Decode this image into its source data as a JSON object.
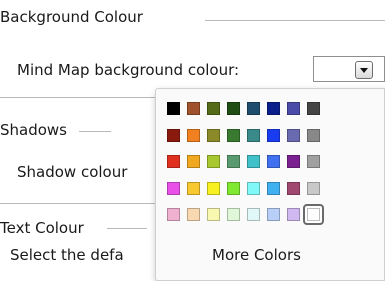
{
  "background": {
    "title": "Background Colour",
    "field_label": "Mind Map background colour:",
    "selected_value": ""
  },
  "shadows": {
    "title": "Shadows",
    "field_label": "Shadow colour"
  },
  "text_colour": {
    "title": "Text Colour",
    "description": "Select the defa"
  },
  "color_popup": {
    "more_colors_label": "More Colors",
    "selected_swatch": "#ffffff",
    "rows": [
      [
        "#000000",
        "#a0522d",
        "#556b1a",
        "#1f4d14",
        "#1e4d6e",
        "#0a1e8c",
        "#4a4aa8",
        "#444444"
      ],
      [
        "#8b1a0e",
        "#f08020",
        "#8a8a28",
        "#3a7a30",
        "#3a8a8a",
        "#1a3cf0",
        "#6a6ab0",
        "#888888"
      ],
      [
        "#e03020",
        "#f0a820",
        "#a8c830",
        "#5a9a70",
        "#40c0c8",
        "#4070f0",
        "#7a2090",
        "#a0a0a0"
      ],
      [
        "#e850e8",
        "#f8c830",
        "#f8f020",
        "#80e830",
        "#80f8f8",
        "#40b0f0",
        "#a04870",
        "#c8c8c8"
      ],
      [
        "#f0b0d0",
        "#f8d8b0",
        "#f8f8b0",
        "#e0f8d8",
        "#e0f8f8",
        "#b8d0f8",
        "#d0b8f0",
        "#ffffff"
      ]
    ]
  }
}
